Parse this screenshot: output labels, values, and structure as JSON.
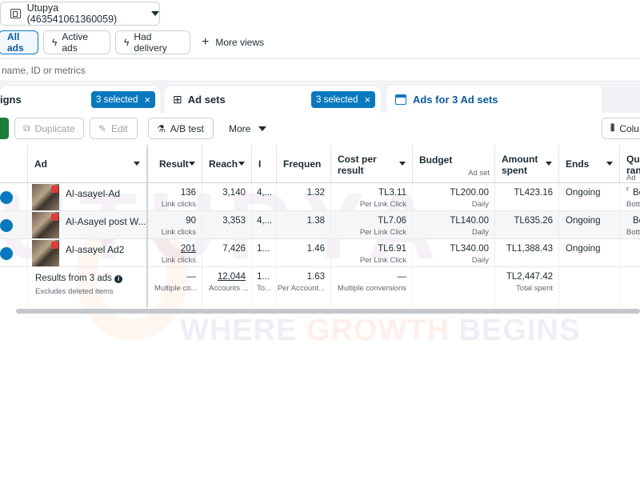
{
  "account": {
    "name": "Utupya (463541061360059)",
    "icon": "ad-account-icon"
  },
  "views": [
    {
      "label": "All ads",
      "active": true
    },
    {
      "label": "Active ads",
      "icon": "lightning-icon"
    },
    {
      "label": "Had delivery",
      "icon": "lightning-icon"
    }
  ],
  "more_views": {
    "label": "More views",
    "icon": "plus-icon"
  },
  "search": {
    "placeholder": "name, ID or metrics"
  },
  "level_tabs": {
    "campaigns": {
      "label": "igns",
      "selected": "3 selected"
    },
    "ad_sets": {
      "label": "Ad sets",
      "selected": "3 selected",
      "icon": "grid-icon"
    },
    "ads": {
      "label": "Ads for 3 Ad sets",
      "icon": "ads-icon"
    }
  },
  "toolbar": {
    "duplicate": "Duplicate",
    "edit": "Edit",
    "ab_test": "A/B test",
    "more": "More",
    "columns": "Colu"
  },
  "columns": {
    "ad": "Ad",
    "result": "Result",
    "reach": "Reach",
    "impressions": "I",
    "frequency": "Frequen",
    "cost_per_result": "Cost per result",
    "budget": "Budget",
    "budget_sub": "Ad set",
    "amount_spent": "Amount spent",
    "ends": "Ends",
    "quality": "Qua ran",
    "quality_sub": "Ad r"
  },
  "rows": [
    {
      "name": "Al-asayel-Ad",
      "result": "136",
      "result_sub": "Link clicks",
      "reach": "3,140",
      "impressions": "4,...",
      "frequency": "1.32",
      "cpr": "TL3.11",
      "cpr_sub": "Per Link Click",
      "budget": "TL200.00",
      "budget_sub": "Daily",
      "spent": "TL423.16",
      "ends": "Ongoing",
      "quality": "Be",
      "quality_sub": "Bott"
    },
    {
      "name": "Al-Asayel post W...",
      "result": "90",
      "result_sub": "Link clicks",
      "reach": "3,353",
      "impressions": "4,...",
      "frequency": "1.38",
      "cpr": "TL7.06",
      "cpr_sub": "Per Link Click",
      "budget": "TL140.00",
      "budget_sub": "Daily",
      "spent": "TL635.26",
      "ends": "Ongoing",
      "quality": "Be",
      "quality_sub": "Bott"
    },
    {
      "name": "Al-asayel Ad2",
      "result": "201",
      "result_sub": "Link clicks",
      "reach": "7,426",
      "impressions": "1...",
      "frequency": "1.46",
      "cpr": "TL6.91",
      "cpr_sub": "Per Link Click",
      "budget": "TL340.00",
      "budget_sub": "Daily",
      "spent": "TL1,388.43",
      "ends": "Ongoing",
      "quality": "",
      "quality_sub": ""
    }
  ],
  "summary": {
    "label": "Results from 3 ads",
    "sub": "Excludes deleted items",
    "result": "—",
    "result_sub": "Multiple co...",
    "reach": "12,044",
    "reach_sub": "Accounts ...",
    "impressions": "1...",
    "impressions_sub": "To...",
    "frequency": "1.63",
    "frequency_sub": "Per Account...",
    "cpr": "—",
    "cpr_sub": "Multiple conversions",
    "spent": "TL2,447.42",
    "spent_sub": "Total spent"
  },
  "watermark": {
    "logo": "UTUPYA",
    "tagline_a": "WHERE ",
    "tagline_b": "GROWTH",
    "tagline_c": " BEGINS"
  }
}
